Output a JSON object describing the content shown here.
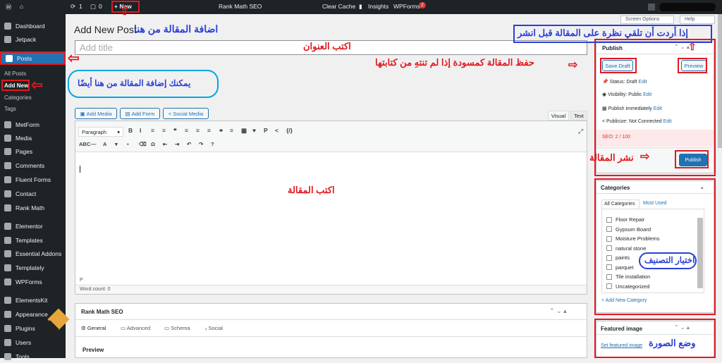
{
  "adminbar": {
    "comments": "1",
    "notif": "0",
    "new_label": "+ New",
    "rankmath": "Rank Math SEO",
    "clear_cache": "Clear Cache",
    "insights": "Insights",
    "wpforms": "WPForms",
    "wpforms_badge": "2"
  },
  "screen_options": "Screen Options",
  "help": "Help",
  "sidebar": {
    "items": [
      "Dashboard",
      "Jetpack",
      "Posts",
      "MetForm",
      "Media",
      "Pages",
      "Comments",
      "Fluent Forms",
      "Contact",
      "Rank Math",
      "Elementor",
      "Templates",
      "Essential Addons",
      "Templately",
      "WPForms",
      "ElementsKit",
      "Appearance",
      "Plugins",
      "Users",
      "Tools"
    ],
    "submenu": [
      "All Posts",
      "Add New",
      "Categories",
      "Tags"
    ]
  },
  "editor": {
    "page_title": "Add New Post",
    "title_placeholder": "Add title",
    "add_media": "Add Media",
    "add_form": "Add Form",
    "social_media": "Social Media",
    "tab_visual": "Visual",
    "tab_text": "Text",
    "format": "Paragraph",
    "path": "P",
    "word_count": "Word count: 0"
  },
  "toolbar1": [
    "B",
    "I",
    "≡",
    "≡",
    "❝",
    "≡",
    "≡",
    "≡",
    "⚭",
    "≡",
    "▦",
    "♥",
    "P",
    "<",
    "{/}"
  ],
  "toolbar2": [
    "ABC",
    "—",
    "A",
    "▾",
    "▪",
    "⌫",
    "Ω",
    "⇤",
    "⇥",
    "↶",
    "↷",
    "?"
  ],
  "publish": {
    "title": "Publish",
    "save_draft": "Save Draft",
    "preview": "Preview",
    "status": "Status: Draft",
    "visibility": "Visibility: Public",
    "publish_when": "Publish immediately",
    "publicize": "Publicize: Not Connected",
    "edit": "Edit",
    "seo": "SEO: 2 / 100",
    "publish_btn": "Publish"
  },
  "categories": {
    "title": "Categories",
    "tab_all": "All Categories",
    "tab_used": "Most Used",
    "items": [
      "Floor Repair",
      "Gypsum Board",
      "Moisture Problems",
      "natural stone",
      "paints",
      "parquet",
      "Tile installation",
      "Uncategorized"
    ],
    "add_new": "+ Add New Category"
  },
  "featured": {
    "title": "Featured image",
    "set": "Set featured image"
  },
  "rankmath": {
    "title": "Rank Math SEO",
    "tabs": [
      "General",
      "Advanced",
      "Schema",
      "Social"
    ],
    "preview": "Preview"
  },
  "annotations": {
    "add_post_here": "اضافة المقالة من هنا",
    "write_title": "اكتب العنوان",
    "preview_note": "إذا أردت أن تلقي نظرة على المقالة قبل انشر",
    "save_note": "حفظ المقالة كمسودة إذا لم تنتهِ من كتابتها",
    "add_also": "يمكنك إضافة المقالة من هنا أيضًا",
    "write_article": "اكتب المقالة",
    "publish_note": "نشر المقالة",
    "choose_category": "اختيار التصنيف",
    "set_image": "وضع الصورة"
  },
  "colors": {
    "accent": "#2271b1",
    "annotation_red": "#e0191f",
    "annotation_blue": "#2a3fd6"
  }
}
